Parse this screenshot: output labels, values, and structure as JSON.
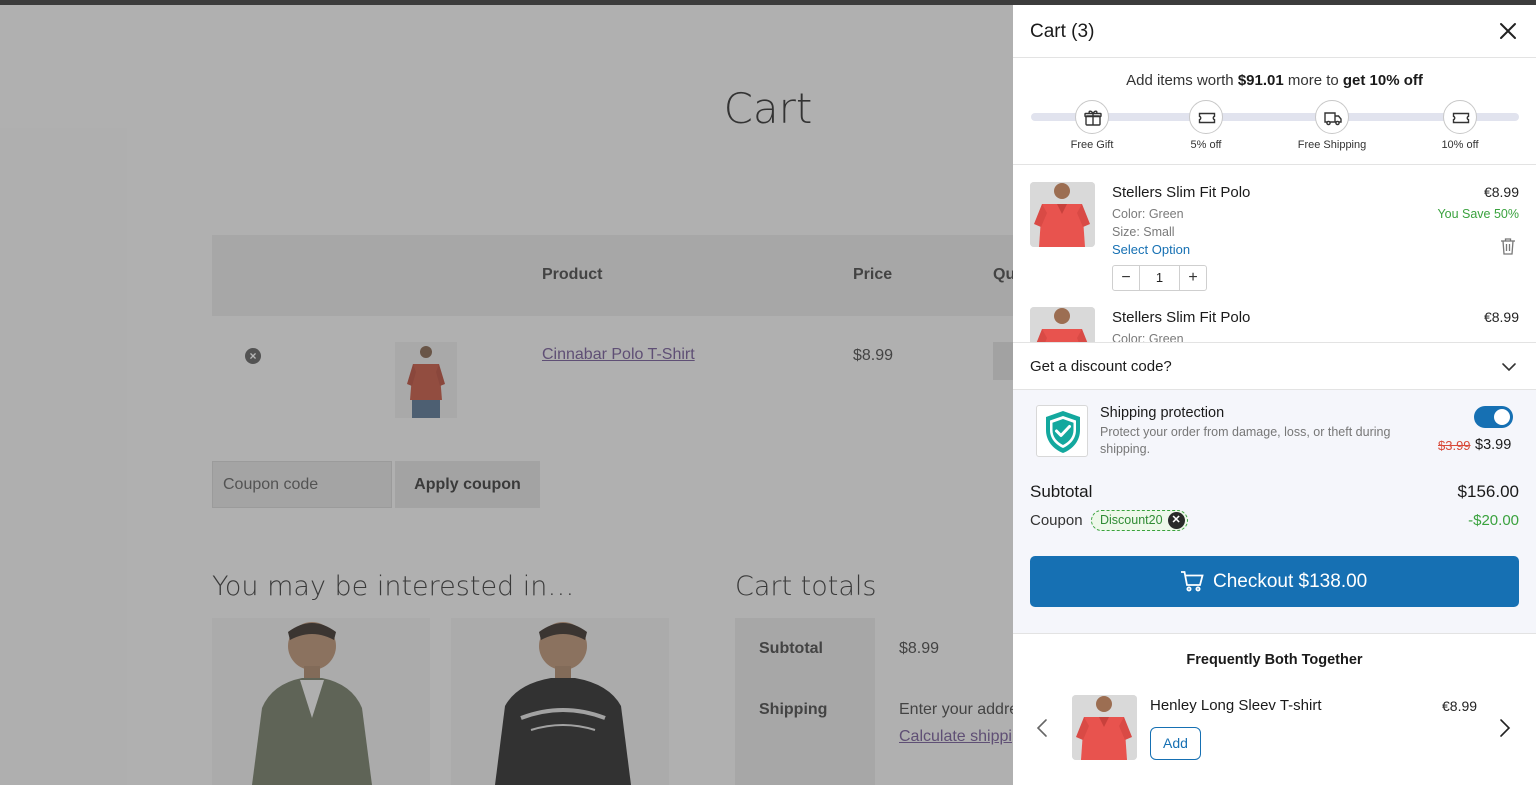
{
  "store": {
    "page_title": "Cart",
    "table_headers": {
      "product": "Product",
      "price": "Price",
      "quantity": "Qu"
    },
    "row": {
      "remove_icon": "×",
      "product_name": "Cinnabar Polo T-Shirt",
      "price": "$8.99"
    },
    "coupon_placeholder": "Coupon code",
    "apply_coupon": "Apply coupon",
    "interested_title": "You may be interested in…",
    "totals_title": "Cart totals",
    "totals": {
      "subtotal_label": "Subtotal",
      "subtotal_value": "$8.99",
      "shipping_label": "Shipping",
      "shipping_text": "Enter your addre",
      "calc_link": "Calculate shippi"
    }
  },
  "drawer": {
    "title": "Cart (3)",
    "progress": {
      "msg_prefix": "Add items worth ",
      "msg_amount": "$91.01",
      "msg_middle": " more to ",
      "msg_reward": "get 10% off",
      "milestones": [
        {
          "label": "Free Gift",
          "icon": "gift-icon"
        },
        {
          "label": "5% off",
          "icon": "ticket-icon"
        },
        {
          "label": "Free Shipping",
          "icon": "truck-icon"
        },
        {
          "label": "10% off",
          "icon": "ticket-icon"
        }
      ]
    },
    "items": [
      {
        "name": "Stellers Slim Fit Polo",
        "color": "Color: Green",
        "size": "Size: Small",
        "select": "Select Option",
        "price": "€8.99",
        "save": "You Save 50%",
        "qty": "1"
      },
      {
        "name": "Stellers Slim Fit Polo",
        "color": "Color: Green",
        "price": "€8.99"
      }
    ],
    "discount_label": "Get a discount code?",
    "protection": {
      "title": "Shipping protection",
      "desc": "Protect your order from damage, loss, or theft during shipping.",
      "old_price": "$3.99",
      "new_price": "$3.99",
      "enabled": true
    },
    "subtotal_label": "Subtotal",
    "subtotal_value": "$156.00",
    "coupon_label": "Coupon",
    "coupon_code": "Discount20",
    "coupon_value": "-$20.00",
    "checkout_label": "Checkout $138.00",
    "fbt": {
      "title": "Frequently Both Together",
      "product_name": "Henley Long Sleev T-shirt",
      "price": "€8.99",
      "add_label": "Add"
    }
  },
  "colors": {
    "accent": "#1670b3",
    "success": "#3aa23e",
    "strike": "#d84a3a",
    "shield": "#13a89e"
  }
}
